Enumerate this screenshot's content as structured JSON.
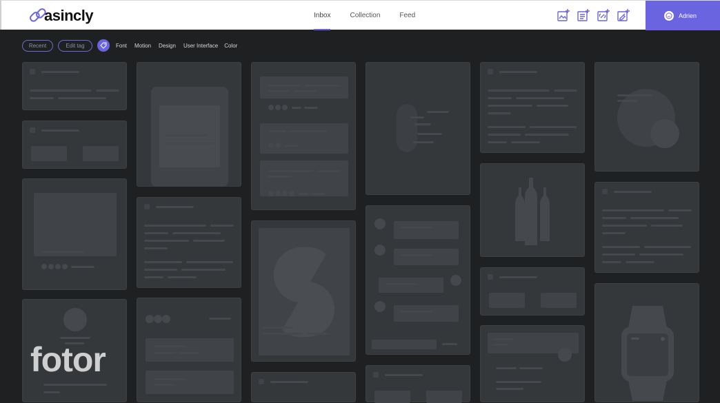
{
  "brand": {
    "name": "asincly"
  },
  "nav": {
    "tabs": [
      {
        "label": "Inbox"
      },
      {
        "label": "Collection"
      },
      {
        "label": "Feed"
      }
    ]
  },
  "actions": [
    {
      "icon": "add-image-icon"
    },
    {
      "icon": "add-note-icon"
    },
    {
      "icon": "add-link-icon"
    },
    {
      "icon": "add-color-icon"
    }
  ],
  "user": {
    "name": "Adrien"
  },
  "filters": {
    "recent_label": "Recent",
    "edit_tag_label": "Edit tag",
    "tags": [
      "Font",
      "Motion",
      "Design",
      "User Interface",
      "Color"
    ]
  },
  "watermark": "fotor",
  "colors": {
    "accent": "#6a64e0",
    "background": "#1f2022",
    "card": "#35383b"
  }
}
